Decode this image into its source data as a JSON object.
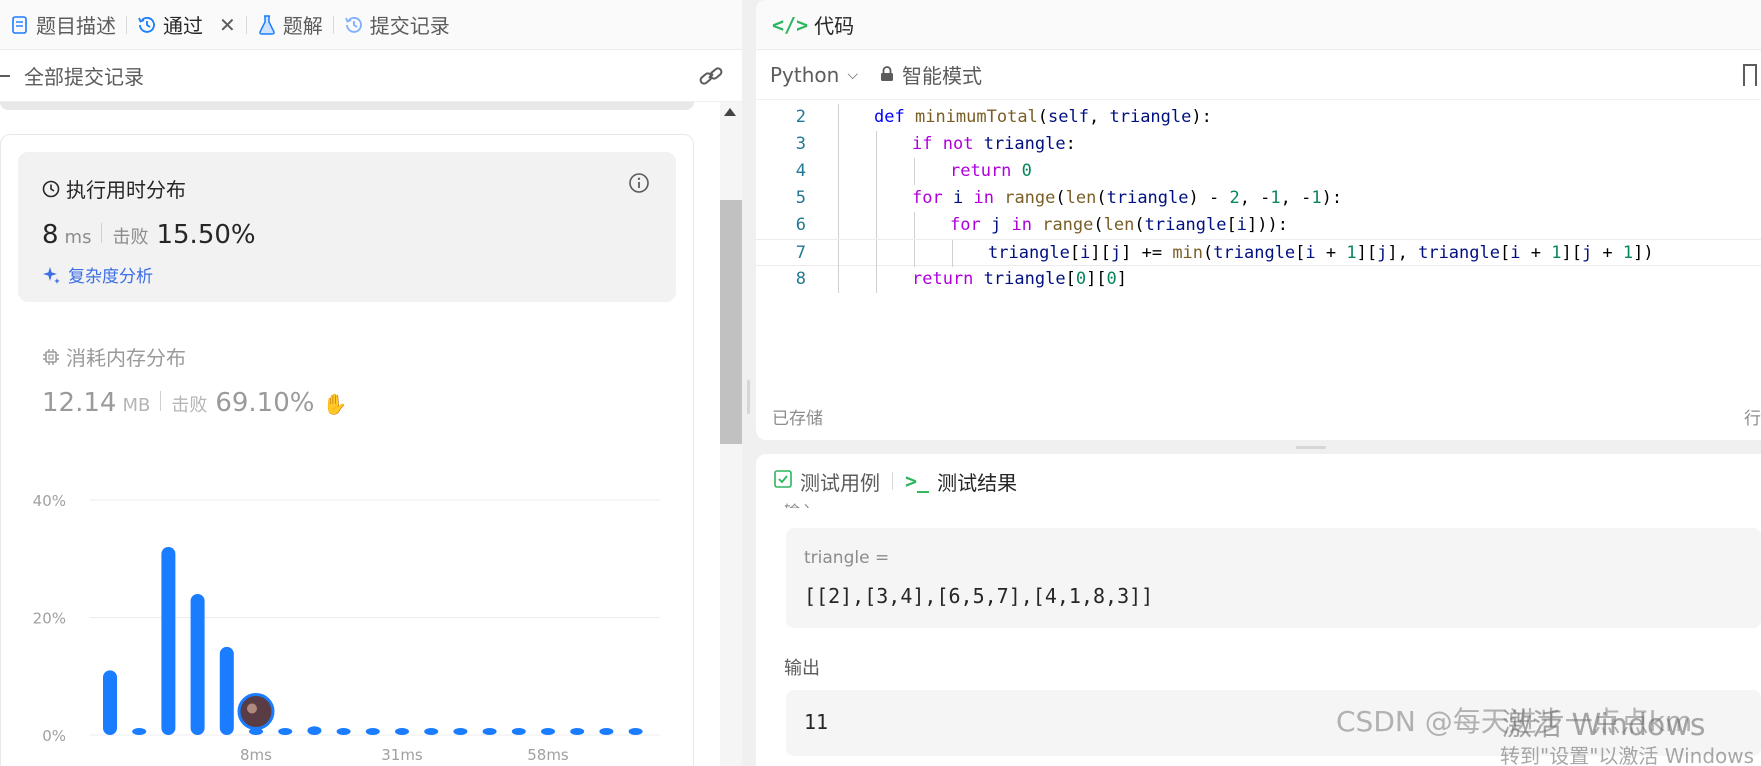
{
  "left": {
    "tabs": [
      {
        "label": "题目描述",
        "icon": "document-icon"
      },
      {
        "label": "通过",
        "icon": "history-icon"
      },
      {
        "label": "题解",
        "icon": "flask-icon"
      },
      {
        "label": "提交记录",
        "icon": "history-icon"
      }
    ],
    "sub_header": "全部提交记录",
    "runtime": {
      "title": "执行用时分布",
      "value": "8",
      "unit": "ms",
      "beat_label": "击败",
      "beat": "15.50%",
      "analysis": "复杂度分析"
    },
    "memory": {
      "title": "消耗内存分布",
      "value": "12.14",
      "unit": "MB",
      "beat_label": "击败",
      "beat": "69.10%"
    }
  },
  "chart_data": {
    "type": "bar",
    "y_ticks": [
      "40%",
      "20%",
      "0%"
    ],
    "ylim": [
      0,
      40
    ],
    "x_labels": [
      "8ms",
      "31ms",
      "58ms"
    ],
    "values": [
      11,
      1,
      32,
      24,
      15,
      1,
      1,
      1.5,
      1,
      1,
      1,
      1,
      1,
      1,
      1,
      1,
      1,
      1,
      1
    ],
    "highlight_index": 5,
    "bar_color": "#1a7cff",
    "grid": true
  },
  "code": {
    "title": "代码",
    "language": "Python",
    "mode": "智能模式",
    "saved": "已存储",
    "saved_right": "行",
    "lines": [
      {
        "n": "2",
        "text": "def minimumTotal(self, triangle):"
      },
      {
        "n": "3",
        "text": "if not triangle:"
      },
      {
        "n": "4",
        "text": "return 0"
      },
      {
        "n": "5",
        "text": "for i in range(len(triangle) - 2, -1, -1):"
      },
      {
        "n": "6",
        "text": "for j in range(len(triangle[i])):"
      },
      {
        "n": "7",
        "text": "triangle[i][j] += min(triangle[i + 1][j], triangle[i + 1][j + 1])"
      },
      {
        "n": "8",
        "text": "return triangle[0][0]"
      }
    ]
  },
  "test": {
    "tab_cases": "测试用例",
    "tab_results": "测试结果",
    "input_label": "输入",
    "var_name": "triangle =",
    "var_value": "[[2],[3,4],[6,5,7],[4,1,8,3]]",
    "output_label": "输出",
    "output_value": "11"
  },
  "overlay": {
    "watermark": "CSDN @每天进步一点点km",
    "activate_1": "激活 Windows",
    "activate_2": "转到\"设置\"以激活 Windows"
  }
}
